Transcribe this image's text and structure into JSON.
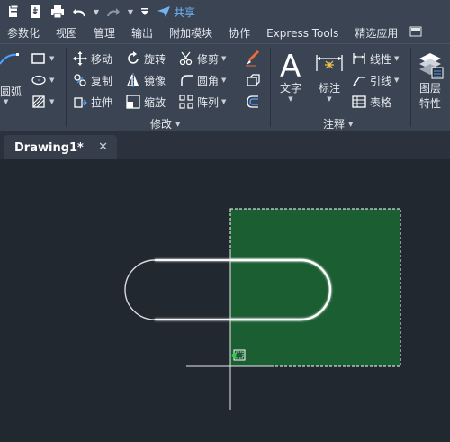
{
  "quick_access": {
    "share_label": "共享"
  },
  "ribbon_tabs": [
    "参数化",
    "视图",
    "管理",
    "输出",
    "附加模块",
    "协作",
    "Express Tools",
    "精选应用"
  ],
  "draw_panel": {
    "arc_label": "圆弧"
  },
  "modify_panel": {
    "move": "移动",
    "rotate": "旋转",
    "trim": "修剪",
    "copy": "复制",
    "mirror": "镜像",
    "fillet": "圆角",
    "stretch": "拉伸",
    "scale": "缩放",
    "array": "阵列",
    "group_label": "修改"
  },
  "annotation_panel": {
    "text": "文字",
    "dimension": "标注",
    "linear": "线性",
    "leader": "引线",
    "table": "表格",
    "group_label": "注释"
  },
  "layers_panel": {
    "properties_line1": "图层",
    "properties_line2": "特性"
  },
  "document": {
    "tab_title": "Drawing1*",
    "close_glyph": "✕"
  },
  "colors": {
    "ribbon_bg": "#3b4453",
    "canvas_bg": "#212830",
    "selection_fill": "#1b5e32",
    "accent_blue": "#6fb3f0"
  }
}
